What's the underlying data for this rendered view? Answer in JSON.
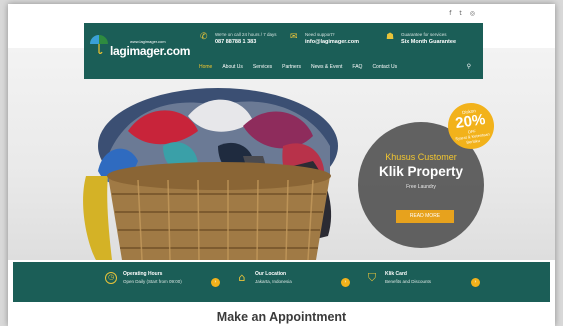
{
  "social": {
    "facebook": "f",
    "twitter": "t",
    "instagram": "◎"
  },
  "logo": {
    "small_text": "www.lagimager.com",
    "brand": "lagimager.com"
  },
  "header": {
    "call": {
      "icon": "phone-icon",
      "label": "We're on call 24 hours / 7 days",
      "value": "087 88788 1 383"
    },
    "support": {
      "icon": "envelope-icon",
      "label": "Need support?",
      "value": "info@lagimager.com"
    },
    "guarantee": {
      "icon": "bag-icon",
      "label": "Guarantee for services",
      "value": "Six Month Guarantee"
    }
  },
  "nav": {
    "items": [
      "Home",
      "About Us",
      "Services",
      "Partners",
      "News & Event",
      "FAQ",
      "Contact Us"
    ],
    "active_index": 0,
    "search_icon": "search-icon"
  },
  "promo": {
    "subtitle": "Khusus Customer",
    "title": "Klik Property",
    "tagline": "Free Laundry",
    "button": "READ MORE"
  },
  "badge": {
    "top": "Diskon",
    "percent": "20%",
    "off": "OFF",
    "note": "Syarat & Ketentuan Berlaku"
  },
  "infobar": {
    "hours": {
      "title": "Operating Hours",
      "text": "Open Daily (Start from 09:00)"
    },
    "location": {
      "title": "Our Location",
      "text": "Jakarta, Indonesia"
    },
    "card": {
      "title": "Klik Card",
      "text": "Benefits and Discounts"
    }
  },
  "section_title": "Make an Appointment",
  "colors": {
    "teal": "#1b5e57",
    "gold": "#f2b21b",
    "yellow_text": "#f2c62f",
    "promo_bg": "#555555"
  }
}
